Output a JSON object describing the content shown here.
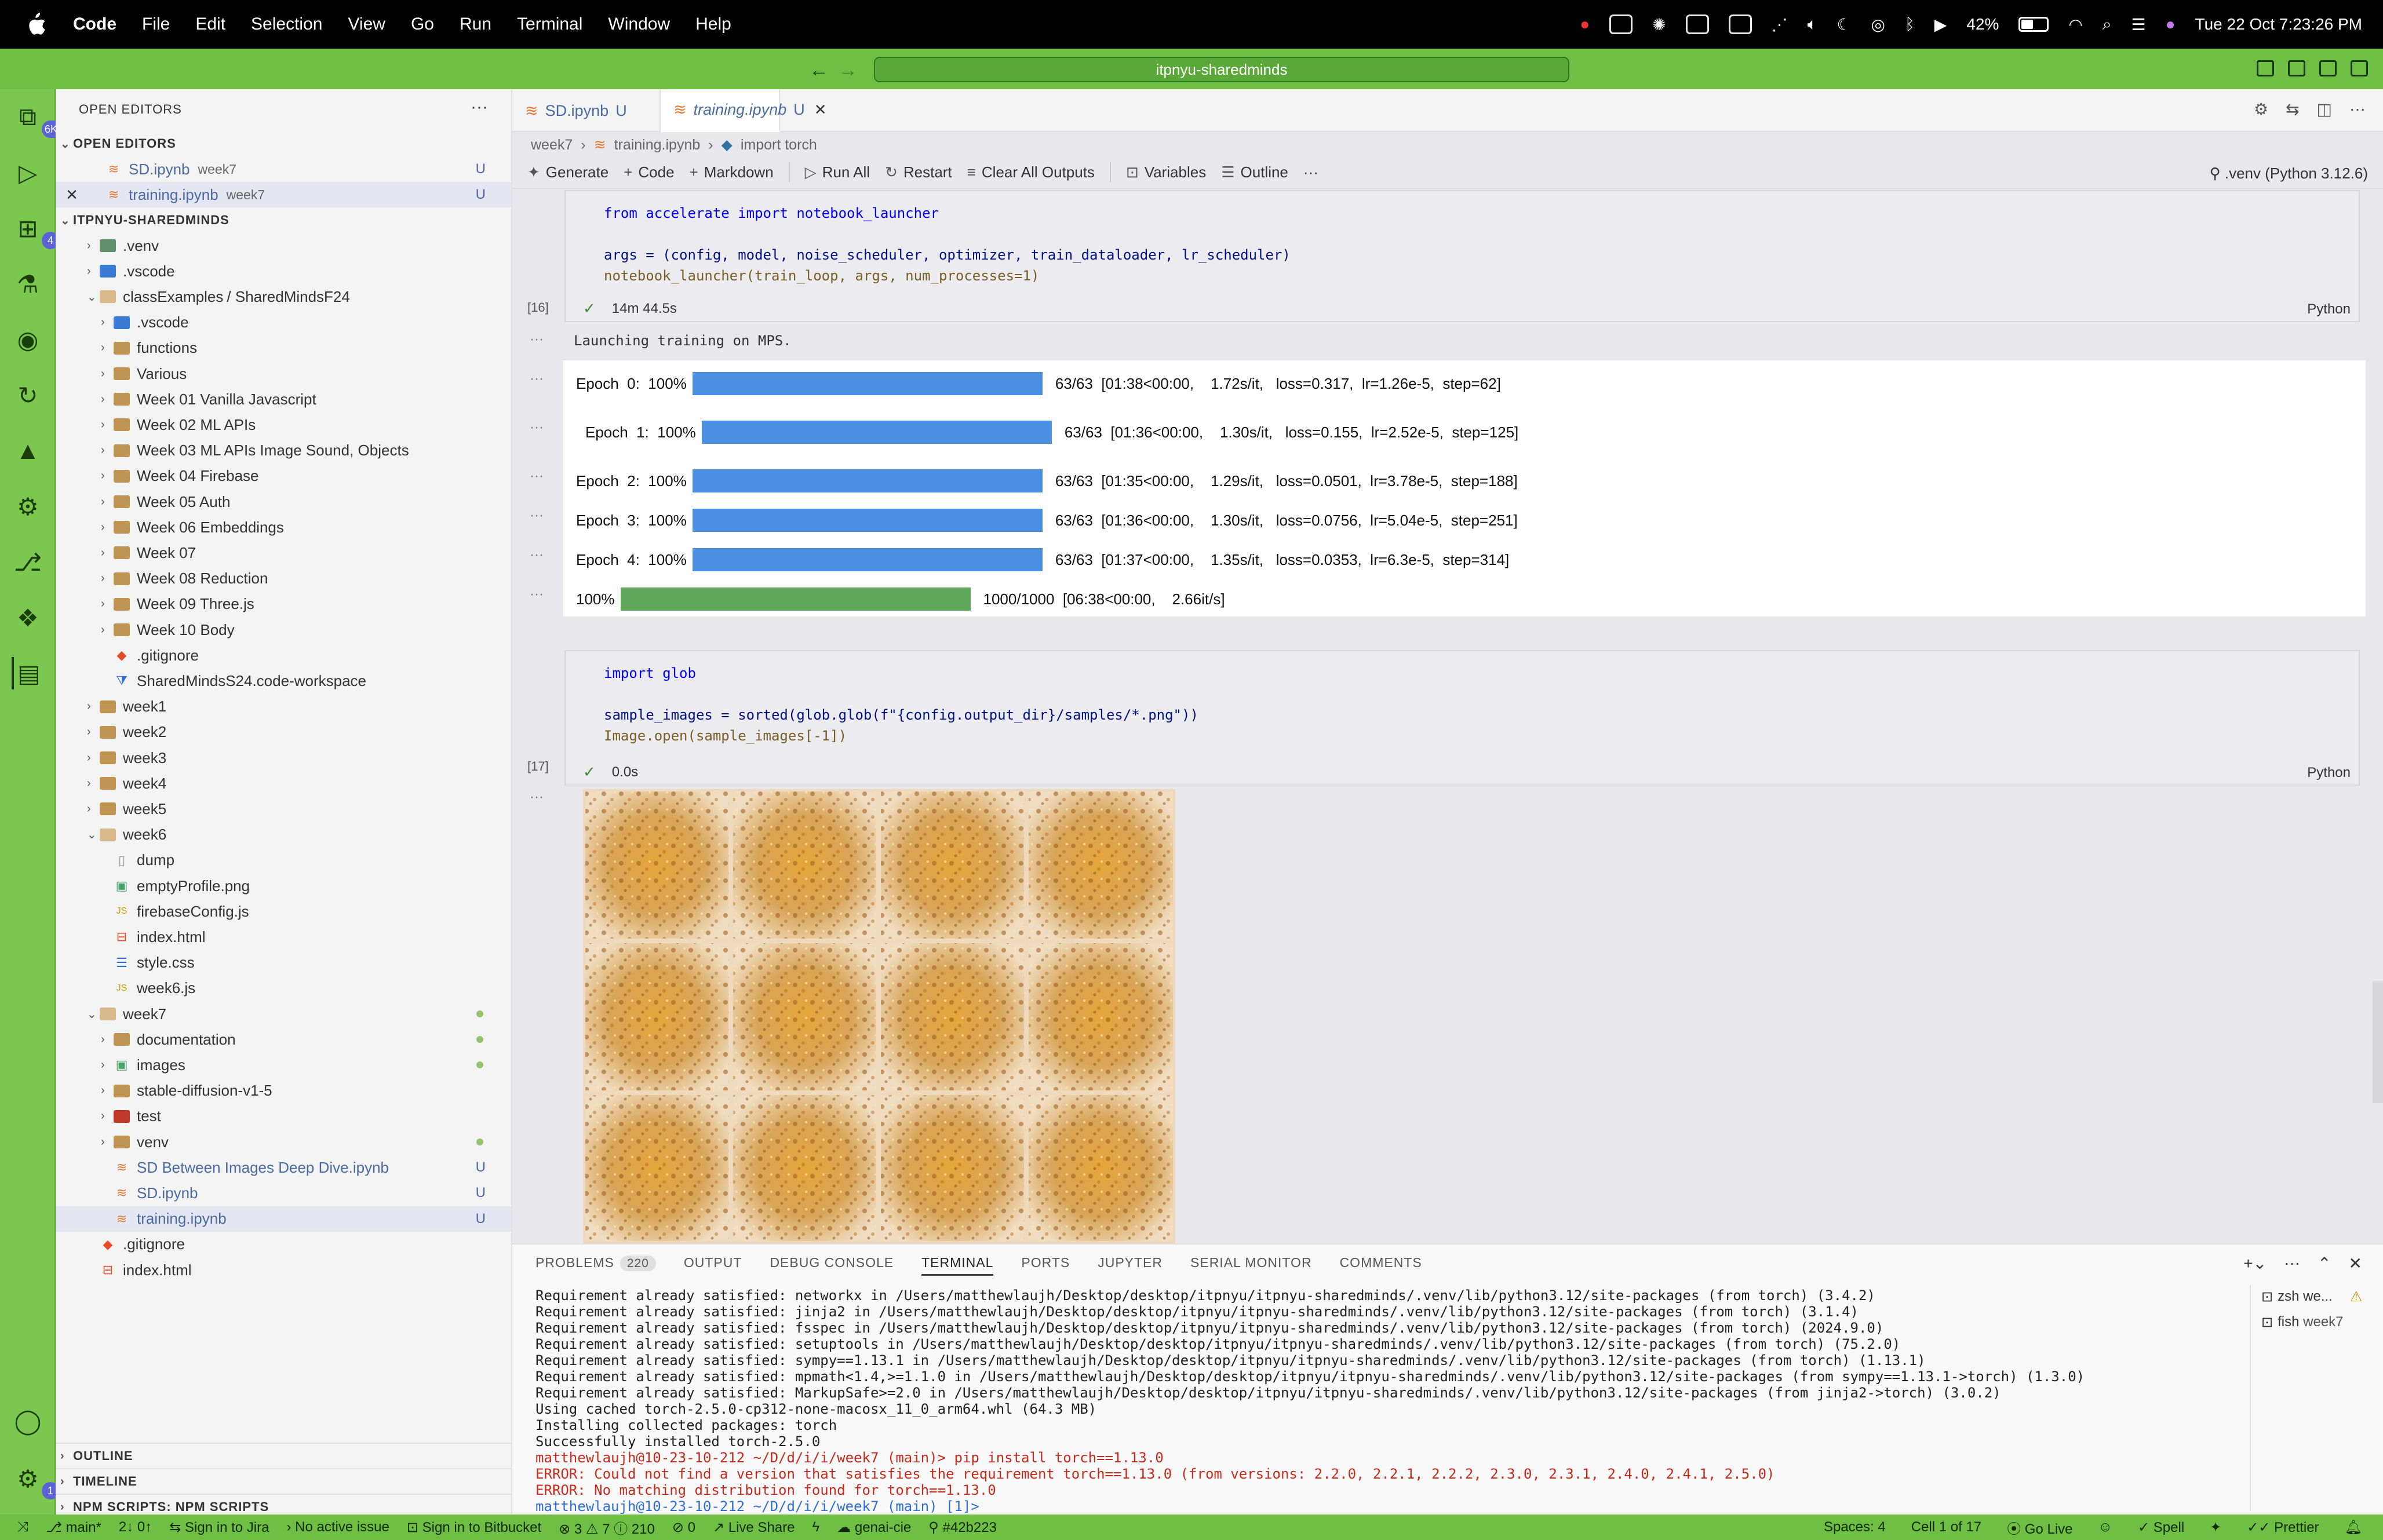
{
  "menubar": {
    "items": [
      "Code",
      "File",
      "Edit",
      "Selection",
      "View",
      "Go",
      "Run",
      "Terminal",
      "Window",
      "Help"
    ],
    "battery": "42%",
    "clock": "Tue 22 Oct  7:23:26 PM"
  },
  "titlebar": {
    "command_center": "itpnyu-sharedminds"
  },
  "activity": {
    "explorer_badge": "6K+",
    "extensions_badge": "4",
    "settings_badge": "1"
  },
  "sidebar": {
    "title": "OPEN EDITORS",
    "open_editors_header": "OPEN EDITORS",
    "open_editors": [
      {
        "name": "SD.ipynb",
        "hint": "week7",
        "mark": "U"
      },
      {
        "name": "training.ipynb",
        "hint": "week7",
        "mark": "U"
      }
    ],
    "workspace_header": "ITPNYU-SHAREDMINDS",
    "tree": [
      {
        "name": ".venv"
      },
      {
        "name": ".vscode"
      },
      {
        "name": "classExamples",
        "suffix": "/ SharedMindsF24"
      },
      {
        "name": ".vscode"
      },
      {
        "name": "functions"
      },
      {
        "name": "Various"
      },
      {
        "name": "Week 01  Vanilla Javascript"
      },
      {
        "name": "Week 02 ML APIs"
      },
      {
        "name": "Week 03 ML APIs Image Sound, Objects"
      },
      {
        "name": "Week 04 Firebase"
      },
      {
        "name": "Week 05 Auth"
      },
      {
        "name": "Week 06 Embeddings"
      },
      {
        "name": "Week 07"
      },
      {
        "name": "Week 08 Reduction"
      },
      {
        "name": "Week 09 Three.js"
      },
      {
        "name": "Week 10 Body"
      },
      {
        "name": ".gitignore"
      },
      {
        "name": "SharedMindsS24.code-workspace"
      },
      {
        "name": "week1"
      },
      {
        "name": "week2"
      },
      {
        "name": "week3"
      },
      {
        "name": "week4"
      },
      {
        "name": "week5"
      },
      {
        "name": "week6"
      },
      {
        "name": "dump"
      },
      {
        "name": "emptyProfile.png"
      },
      {
        "name": "firebaseConfig.js"
      },
      {
        "name": "index.html"
      },
      {
        "name": "style.css"
      },
      {
        "name": "week6.js"
      },
      {
        "name": "week7"
      },
      {
        "name": "documentation"
      },
      {
        "name": "images"
      },
      {
        "name": "stable-diffusion-v1-5"
      },
      {
        "name": "test"
      },
      {
        "name": "venv"
      },
      {
        "name": "SD Between Images Deep Dive.ipynb",
        "mark": "U"
      },
      {
        "name": "SD.ipynb",
        "mark": "U"
      },
      {
        "name": "training.ipynb",
        "mark": "U"
      },
      {
        "name": ".gitignore"
      },
      {
        "name": "index.html"
      }
    ],
    "bottom_sections": [
      "OUTLINE",
      "TIMELINE",
      "NPM SCRIPTS: NPM SCRIPTS"
    ]
  },
  "editor": {
    "tabs": [
      {
        "name": "SD.ipynb",
        "mark": "U"
      },
      {
        "name": "training.ipynb",
        "mark": "U"
      }
    ],
    "breadcrumb": [
      "week7",
      "training.ipynb",
      "import torch"
    ],
    "toolbar": [
      "Generate",
      "Code",
      "Markdown",
      "Run All",
      "Restart",
      "Clear All Outputs",
      "Variables",
      "Outline"
    ],
    "kernel": ".venv (Python 3.12.6)",
    "cell16": {
      "exec": "[16]",
      "line1": "from accelerate import notebook_launcher",
      "line2": "args = (config, model, noise_scheduler, optimizer, train_dataloader, lr_scheduler)",
      "line3": "notebook_launcher(train_loop, args, num_processes=1)",
      "status": "14m 44.5s",
      "lang": "Python",
      "output": "Launching training on MPS."
    },
    "progress": [
      {
        "label": "Epoch  0:  100%",
        "stats": "63/63  [01:38<00:00,    1.72s/it,   loss=0.317,  lr=1.26e-5,  step=62]",
        "fraction": 1.0
      },
      {
        "label": "Epoch  1:  100%",
        "stats": "63/63  [01:36<00:00,    1.30s/it,   loss=0.155,  lr=2.52e-5,  step=125]",
        "fraction": 1.0
      },
      {
        "label": "Epoch  2:  100%",
        "stats": "63/63  [01:35<00:00,    1.29s/it,   loss=0.0501,  lr=3.78e-5,  step=188]",
        "fraction": 1.0
      },
      {
        "label": "Epoch  3:  100%",
        "stats": "63/63  [01:36<00:00,    1.30s/it,   loss=0.0756,  lr=5.04e-5,  step=251]",
        "fraction": 1.0
      },
      {
        "label": "Epoch  4:  100%",
        "stats": "63/63  [01:37<00:00,    1.35s/it,   loss=0.0353,  lr=6.3e-5,  step=314]",
        "fraction": 1.0
      },
      {
        "label": "100%",
        "stats": "1000/1000  [06:38<00:00,    2.66it/s]",
        "fraction": 1.0
      }
    ],
    "cell17": {
      "exec": "[17]",
      "line1": "import glob",
      "line2": "sample_images = sorted(glob.glob(f\"{config.output_dir}/samples/*.png\"))",
      "line3": "Image.open(sample_images[-1])",
      "status": "0.0s",
      "lang": "Python"
    }
  },
  "panel": {
    "tabs": [
      "PROBLEMS",
      "OUTPUT",
      "DEBUG CONSOLE",
      "TERMINAL",
      "PORTS",
      "JUPYTER",
      "SERIAL MONITOR",
      "COMMENTS"
    ],
    "problems_count": "220",
    "terminal_lines": [
      "Requirement already satisfied: networkx in /Users/matthewlaujh/Desktop/desktop/itpnyu/itpnyu-sharedminds/.venv/lib/python3.12/site-packages (from torch) (3.4.2)",
      "Requirement already satisfied: jinja2 in /Users/matthewlaujh/Desktop/desktop/itpnyu/itpnyu-sharedminds/.venv/lib/python3.12/site-packages (from torch) (3.1.4)",
      "Requirement already satisfied: fsspec in /Users/matthewlaujh/Desktop/desktop/itpnyu/itpnyu-sharedminds/.venv/lib/python3.12/site-packages (from torch) (2024.9.0)",
      "Requirement already satisfied: setuptools in /Users/matthewlaujh/Desktop/desktop/itpnyu/itpnyu-sharedminds/.venv/lib/python3.12/site-packages (from torch) (75.2.0)",
      "Requirement already satisfied: sympy==1.13.1 in /Users/matthewlaujh/Desktop/desktop/itpnyu/itpnyu-sharedminds/.venv/lib/python3.12/site-packages (from torch) (1.13.1)",
      "Requirement already satisfied: mpmath<1.4,>=1.1.0 in /Users/matthewlaujh/Desktop/desktop/itpnyu/itpnyu-sharedminds/.venv/lib/python3.12/site-packages (from sympy==1.13.1->torch) (1.3.0)",
      "Requirement already satisfied: MarkupSafe>=2.0 in /Users/matthewlaujh/Desktop/desktop/itpnyu/itpnyu-sharedminds/.venv/lib/python3.12/site-packages (from jinja2->torch) (3.0.2)",
      "Using cached torch-2.5.0-cp312-none-macosx_11_0_arm64.whl (64.3 MB)",
      "Installing collected packages: torch",
      "Successfully installed torch-2.5.0"
    ],
    "prompt_cmd": "matthewlaujh@10-23-10-212 ~/D/d/i/i/week7 (main)> pip install torch==1.13.0",
    "error1": "ERROR: Could not find a version that satisfies the requirement torch==1.13.0 (from versions: 2.2.0, 2.2.1, 2.2.2, 2.3.0, 2.3.1, 2.4.0, 2.4.1, 2.5.0)",
    "error2": "ERROR: No matching distribution found for torch==1.13.0",
    "prompt_last": "matthewlaujh@10-23-10-212 ~/D/d/i/i/week7 (main) [1]>",
    "terminals": [
      {
        "name": "zsh",
        "hint": "we..."
      },
      {
        "name": "fish",
        "hint": "week7"
      }
    ]
  },
  "statusbar": {
    "branch": "main*",
    "sync": "2↓ 0↑",
    "jira": "Sign in to Jira",
    "issue": "No active issue",
    "bitbucket": "Sign in to Bitbucket",
    "problems": "⊗ 3  ⚠ 7  ⓘ 210",
    "ports": "0",
    "liveshare": "Live Share",
    "env": "genai-cie",
    "commit": "#42b223",
    "spaces": "Spaces: 4",
    "cell": "Cell 1 of 17",
    "golive": "Go Live",
    "spell": "Spell",
    "prettier": "Prettier"
  },
  "colors": {
    "accent_green": "#6fbf45",
    "progress_blue": "#4a90e2",
    "progress_green": "#5fa85a"
  }
}
